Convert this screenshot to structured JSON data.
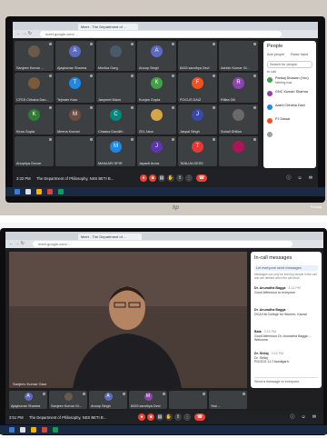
{
  "photo1": {
    "browser": {
      "tab_title": "Meet - The Department of ...",
      "url": "meet.google.com/..."
    },
    "participants": [
      {
        "name": "Sanjeev Kumar ...",
        "initial": "",
        "color": "#6b5a4a"
      },
      {
        "name": "Ajaykumar Sharma",
        "initial": "A",
        "color": "#5c6bc0"
      },
      {
        "name": "Monika Garg",
        "initial": "",
        "color": "#4a5a6a"
      },
      {
        "name": "Anoop Singh",
        "initial": "A",
        "color": "#5c6bc0"
      },
      {
        "name": "8433 sandhya Devi",
        "initial": "",
        "color": "#3c4043"
      },
      {
        "name": "Ashish Kumar Gi...",
        "initial": "",
        "color": "#3c4043"
      },
      {
        "name": "CFSS Chhaha Dan...",
        "initial": "",
        "color": "#7a5a3a"
      },
      {
        "name": "Tejinder Kaur",
        "initial": "T",
        "color": "#1e88e5"
      },
      {
        "name": "Jaspreet Mann",
        "initial": "",
        "color": "#3c4043"
      },
      {
        "name": "Kunjan Gupta",
        "initial": "K",
        "color": "#43a047"
      },
      {
        "name": "POCUS DAIZ",
        "initial": "F",
        "color": "#f4511e"
      },
      {
        "name": "Ritika Gill",
        "initial": "R",
        "color": "#8e44ad"
      },
      {
        "name": "Kiran Gupta",
        "initial": "K",
        "color": "#2e7d32"
      },
      {
        "name": "Meena Kumari",
        "initial": "M",
        "color": "#6d4c41"
      },
      {
        "name": "Chaana Dandith",
        "initial": "C",
        "color": "#00897b"
      },
      {
        "name": "201 Jaba",
        "initial": "",
        "color": "#d4a64a"
      },
      {
        "name": "Jaspal Singh",
        "initial": "J",
        "color": "#3949ab"
      },
      {
        "name": "Suhail Dhillon",
        "initial": "",
        "color": "#6a6a6a"
      },
      {
        "name": "Anupriya Grover",
        "initial": "",
        "color": "#3c4043"
      },
      {
        "name": "",
        "initial": "",
        "color": "#3c4043"
      },
      {
        "name": "MANJARI SPIR",
        "initial": "M",
        "color": "#1e88e5"
      },
      {
        "name": "Jayanti Arora",
        "initial": "J",
        "color": "#5e35b1"
      },
      {
        "name": "TANUJA DESS",
        "initial": "T",
        "color": "#e53935"
      },
      {
        "name": "",
        "initial": "",
        "color": "#ad1457"
      }
    ],
    "bottom_bar": {
      "time": "3:32 PM",
      "meeting": "The Department of Philosophy, NSS BETI B..."
    },
    "people_panel": {
      "title": "People",
      "tabs": [
        "Add people",
        "Raise hand"
      ],
      "search_placeholder": "Search for people",
      "section": "In call",
      "people": [
        {
          "name": "Pankaj Dhawan (You)",
          "sub": "Meeting host"
        },
        {
          "name": "GNC Kumari Sharma",
          "sub": ""
        },
        {
          "name": "Aashi Chhaha Dani",
          "sub": ""
        },
        {
          "name": "PJ Dawar",
          "sub": ""
        },
        {
          "name": "",
          "sub": ""
        }
      ]
    },
    "brand": "hp",
    "corner_label": "Pankaj"
  },
  "photo2": {
    "browser": {
      "tab_title": "Meet - The Department of ...",
      "url": "meet.google.com/..."
    },
    "speaker_label": "Sanjeev Kumar Gaur",
    "chat_panel": {
      "title": "In-call messages",
      "toggle_label": "Let everyone send messages",
      "note": "Messages can only be seen by people in the call and are deleted when the call ends",
      "messages": [
        {
          "sender": "Dr. Anuradha Bagga",
          "time": "3:14 PM",
          "text": "Good Afternoon to everyone"
        },
        {
          "sender": "Dr. Anuradha Bagga",
          "time": "",
          "text": "DCA Kitt College for Women, Karnal"
        },
        {
          "sender": "Bala",
          "time": "3:15 PM",
          "text": "Good Afternoon Dr. Anuradha Bagga ... Welcome"
        },
        {
          "sender": "Dr. Shitaj",
          "time": "3:16 PM",
          "text": "Dr. Shitaj\nPGGCG 11 Chandigarh"
        }
      ],
      "input_placeholder": "Send a message to everyone"
    },
    "strip": [
      {
        "name": "Ajaykumar Sharma",
        "initial": "A",
        "color": "#5c6bc0"
      },
      {
        "name": "Sanjeev Kumar Gi...",
        "initial": "",
        "color": "#6b5a4a"
      },
      {
        "name": "Anoop Singh",
        "initial": "A",
        "color": "#5c6bc0"
      },
      {
        "name": "8433 sandhya Devi",
        "initial": "M",
        "color": "#8e44ad"
      },
      {
        "name": "",
        "initial": "",
        "color": "#3c4043"
      },
      {
        "name": "Yosi ...",
        "initial": "",
        "color": "#3c4043"
      }
    ],
    "bottom_bar": {
      "time": "3:51 PM",
      "meeting": "The Department of Philosophy, NSS BETI B..."
    }
  }
}
